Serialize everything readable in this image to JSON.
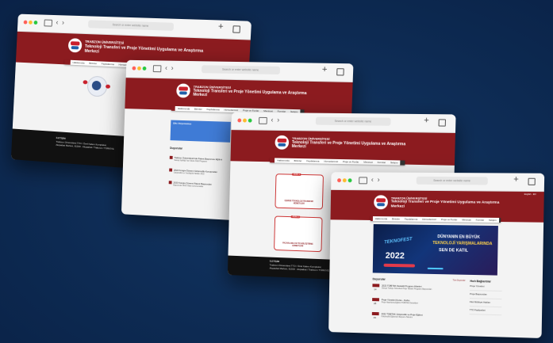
{
  "browser": {
    "url_placeholder": "Search or enter website name",
    "back_glyph": "‹",
    "forward_glyph": "›",
    "new_tab_glyph": "+"
  },
  "site": {
    "title_line1": "TRABZON ÜNİVERSİTESİ",
    "title_line2": "Teknoloji Transferi ve Proje Yönetimi Uygulama ve Araştırma",
    "title_line3": "Merkezi",
    "topbar": "English · EN",
    "menu": [
      "Hakkımızda",
      "Birimler",
      "Faydalanma",
      "Hizmetlerimiz",
      "Proje ve Fonlar",
      "Mevzuat",
      "Formlar",
      "İletişim"
    ]
  },
  "footer": {
    "heading": "İLETİŞİM",
    "address": "Trabzon Üniversitesi TTO / Özel Kalem Kompleksi",
    "phone": "Akçaabat Merkez, 61300 · Akçaabat / Trabzon / TÜRKİYE"
  },
  "win2": {
    "panel_title": "Ofis Vizyonumuz",
    "news_title": "Duyurular",
    "news": [
      {
        "t": "Trabzon Üniversitesi'nde Patent Başvurusu Eğitimi",
        "d": "Sanayi İşbirliği Yaz Okulu Ödül Programı"
      },
      {
        "t": "2022 Kongre Dönemi Girişimcilik Konuşmaları",
        "d": "Girişimcilik ve Yenilikçilik Haftası 2022"
      },
      {
        "t": "2023 Kongre Dönemi Patent Başvuruları",
        "d": "Başvurular 2023 Nisan sonuna kadar"
      }
    ]
  },
  "win3": {
    "box1_caption": "ADIM 1",
    "box1_text": "İÇERDE TEKNOLOJİ TRANSFER HİZMETLERİ",
    "box2_caption": "ADIM 2",
    "box2_text": "PAZARLAMA VE TİCARİLEŞTİRME HİZMETLERİ"
  },
  "win4": {
    "banner_brand": "TEKNOFEST",
    "banner_year": "2022",
    "banner_slogan_1": "DÜNYANIN EN BÜYÜK",
    "banner_slogan_2": "TEKNOLOJİ YARIŞMALARINDA",
    "banner_slogan_3": "SEN DE KATIL",
    "news_title": "Duyurular",
    "all_news": "Tüm Duyurular",
    "news": [
      {
        "day": "14",
        "t": "2022 TÜBİTAK Destekli Program Hibeleri",
        "d": "Dünya Türkiye Teknofest Proje Tabanlı Programı Başvuruları"
      },
      {
        "day": "28",
        "t": "Proje Yönetimi Kursu - Kurbu",
        "d": "Proje Hazırlama Eğitimi TÜBİTAK Destekleri"
      },
      {
        "day": "09",
        "t": "2022 TÜBİTAK Girişimcilik ve Proje Eğitimi",
        "d": "Girişimcilik Eğitimleri Başvuru Takvimi"
      }
    ],
    "links_title": "Hızlı Bağlantılar",
    "links": [
      "Proje Yönetimi",
      "Proje Başvuruları",
      "Fikri Mülkiyet Hakları",
      "TTO Faaliyetleri"
    ]
  }
}
